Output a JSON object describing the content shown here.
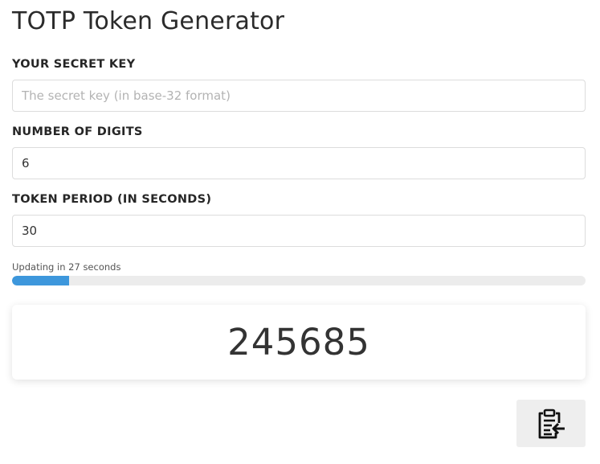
{
  "header": {
    "title": "TOTP Token Generator"
  },
  "form": {
    "secret_key": {
      "label": "YOUR SECRET KEY",
      "value": "",
      "placeholder": "The secret key (in base-32 format)"
    },
    "digits": {
      "label": "NUMBER OF DIGITS",
      "value": "6",
      "placeholder": ""
    },
    "period": {
      "label": "TOKEN PERIOD (IN SECONDS)",
      "value": "30",
      "placeholder": ""
    }
  },
  "progress": {
    "text": "Updating in 27 seconds",
    "fraction": 0.1,
    "color": "#3d97dc",
    "track_color": "#ececec"
  },
  "token": {
    "value": "245685"
  },
  "copy_button": {
    "icon": "clipboard-copy-icon"
  }
}
